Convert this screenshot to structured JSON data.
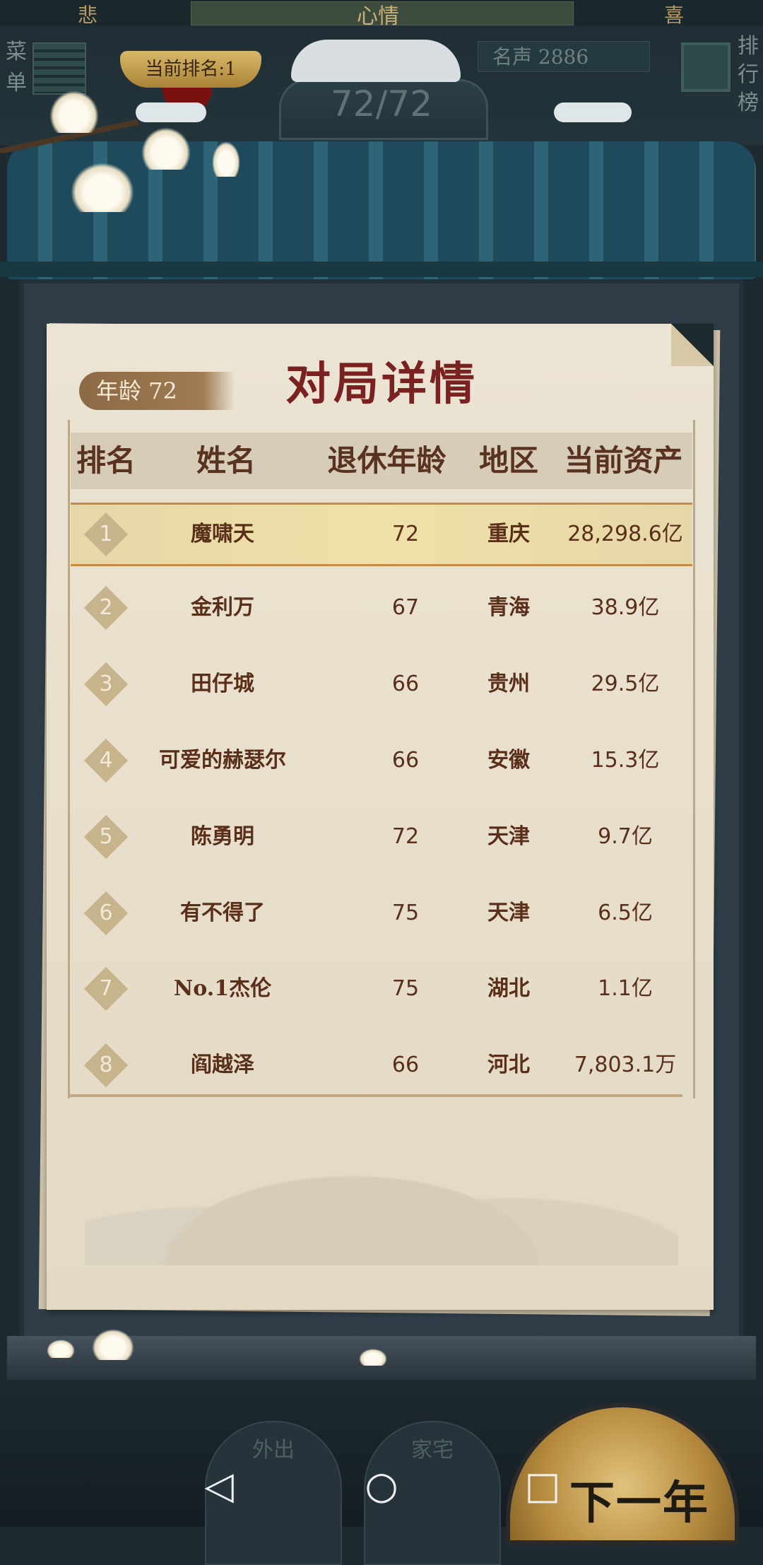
{
  "mood": {
    "left": "悲",
    "center": "心情",
    "right": "喜"
  },
  "header": {
    "menu_label": "菜单",
    "rank_badge": "当前排名:1",
    "fame_label": "名声 2886",
    "ranking_label": "排行榜",
    "age_counter": "72/72"
  },
  "panel": {
    "age_tag": "年龄 72",
    "title": "对局详情",
    "columns": [
      "排名",
      "姓名",
      "退休年龄",
      "地区",
      "当前资产"
    ],
    "rows": [
      {
        "rank": "1",
        "name": "魔啸天",
        "age": "72",
        "region": "重庆",
        "assets": "28,298.6亿"
      },
      {
        "rank": "2",
        "name": "金利万",
        "age": "67",
        "region": "青海",
        "assets": "38.9亿"
      },
      {
        "rank": "3",
        "name": "田仔城",
        "age": "66",
        "region": "贵州",
        "assets": "29.5亿"
      },
      {
        "rank": "4",
        "name": "可爱的赫瑟尔",
        "age": "66",
        "region": "安徽",
        "assets": "15.3亿"
      },
      {
        "rank": "5",
        "name": "陈勇明",
        "age": "72",
        "region": "天津",
        "assets": "9.7亿"
      },
      {
        "rank": "6",
        "name": "有不得了",
        "age": "75",
        "region": "天津",
        "assets": "6.5亿"
      },
      {
        "rank": "7",
        "name": "No.1杰伦",
        "age": "75",
        "region": "湖北",
        "assets": "1.1亿"
      },
      {
        "rank": "8",
        "name": "阎越泽",
        "age": "66",
        "region": "河北",
        "assets": "7,803.1万"
      }
    ]
  },
  "bottom": {
    "outing_label": "外出",
    "house_label": "家宅",
    "next_year_label": "下一年"
  },
  "navbar": {
    "back_icon": "back-triangle-icon",
    "home_icon": "home-circle-icon",
    "recents_icon": "recents-square-icon"
  }
}
